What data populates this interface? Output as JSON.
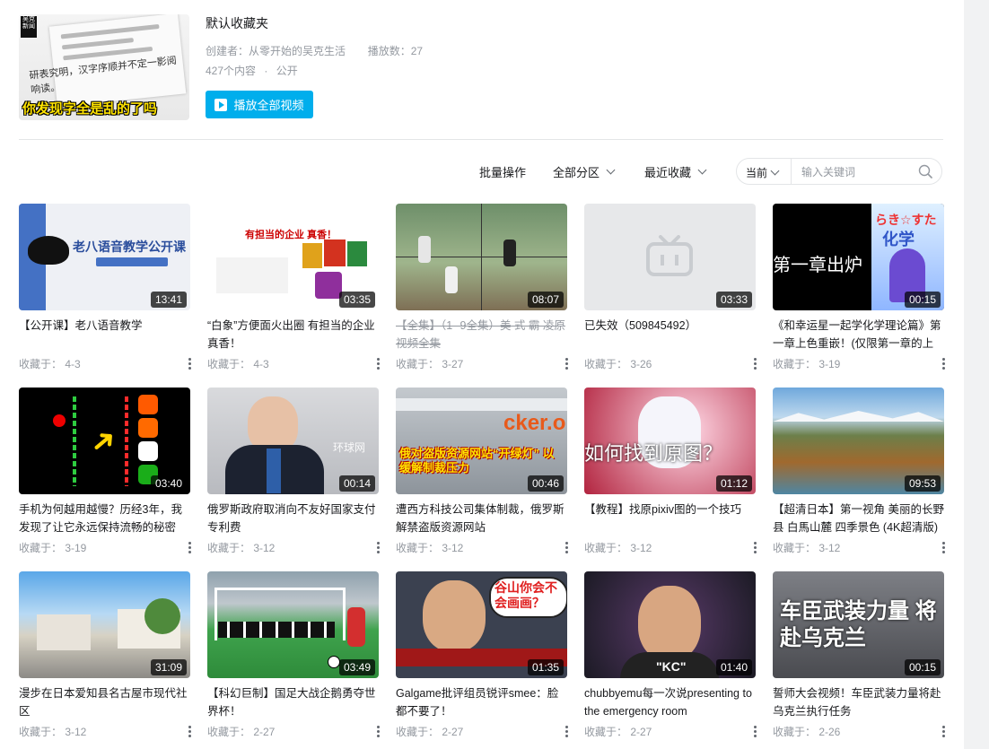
{
  "folder": {
    "title": "默认收藏夹",
    "creator": "创建者：从零开始的吴克生活",
    "plays": "播放数：27",
    "count": "427个内容",
    "visibility": "公开",
    "play_all": "播放全部视频",
    "cover_caption": "你发现字全是乱的了吗",
    "cover_hand": "研表究明，汉字序顺并不定一影阅响读。"
  },
  "toolbar": {
    "batch": "批量操作",
    "category": "全部分区",
    "sort": "最近收藏",
    "scope": "当前",
    "search_placeholder": "输入关键词"
  },
  "videos": [
    {
      "title": "【公开课】老八语音教学",
      "fav": "收藏于： 4-3",
      "duration": "13:41",
      "overlay": "老八语音教学公开课"
    },
    {
      "title": "“白象”方便面火出圈 有担当的企业 真香！",
      "fav": "收藏于： 4-3",
      "duration": "03:35",
      "overlay": "有担当的企业 真香！"
    },
    {
      "title": "【全集】（1--9全集）美 式 霸 凌原视频全集",
      "fav": "收藏于： 3-27",
      "duration": "08:07",
      "overlay": ""
    },
    {
      "title": "已失效（509845492）",
      "fav": "收藏于： 3-26",
      "duration": "03:33",
      "overlay": ""
    },
    {
      "title": "《和幸运星一起学化学理论篇》第一章上色重嵌！(仅限第一章的上色",
      "fav": "收藏于： 3-19",
      "duration": "00:15",
      "overlay": "第一章出炉"
    },
    {
      "title": "手机为何越用越慢？历经3年，我发现了让它永远保持流畅的秘密",
      "fav": "收藏于： 3-19",
      "duration": "03:40",
      "overlay": ""
    },
    {
      "title": "俄罗斯政府取消向不友好国家支付专利费",
      "fav": "收藏于： 3-12",
      "duration": "00:14",
      "overlay": "环球网"
    },
    {
      "title": "遭西方科技公司集体制裁，俄罗斯解禁盗版资源网站",
      "fav": "收藏于： 3-12",
      "duration": "00:46",
      "overlay": "俄对盗版资源网站“开绿灯” 以缓解制裁压力"
    },
    {
      "title": "【教程】找原pixiv图的一个技巧",
      "fav": "收藏于： 3-12",
      "duration": "01:12",
      "overlay": "如何找到原图？"
    },
    {
      "title": "【超清日本】第一视角 美丽的长野县 白馬山麓 四季景色 (4K超清版)",
      "fav": "收藏于： 3-12",
      "duration": "09:53",
      "overlay": ""
    },
    {
      "title": "漫步在日本爱知县名古屋市现代社区",
      "fav": "收藏于： 3-12",
      "duration": "31:09",
      "overlay": ""
    },
    {
      "title": "【科幻巨制】国足大战企鹅勇夺世界杯！",
      "fav": "收藏于： 2-27",
      "duration": "03:49",
      "overlay": ""
    },
    {
      "title": "Galgame批评组员锐评smee：脸都不要了！",
      "fav": "收藏于： 2-27",
      "duration": "01:35",
      "overlay": "谷山你会不会画画？"
    },
    {
      "title": "chubbyemu每一次说presenting to the emergency room",
      "fav": "收藏于： 2-27",
      "duration": "01:40",
      "overlay": "\"KC\""
    },
    {
      "title": "誓师大会视频！车臣武装力量将赴乌克兰执行任务",
      "fav": "收藏于： 2-26",
      "duration": "00:15",
      "overlay": "车臣武装力量 将赴乌克兰"
    }
  ],
  "colors": {
    "accent": "#00aeec",
    "muted": "#9499a0",
    "text": "#18191c"
  }
}
